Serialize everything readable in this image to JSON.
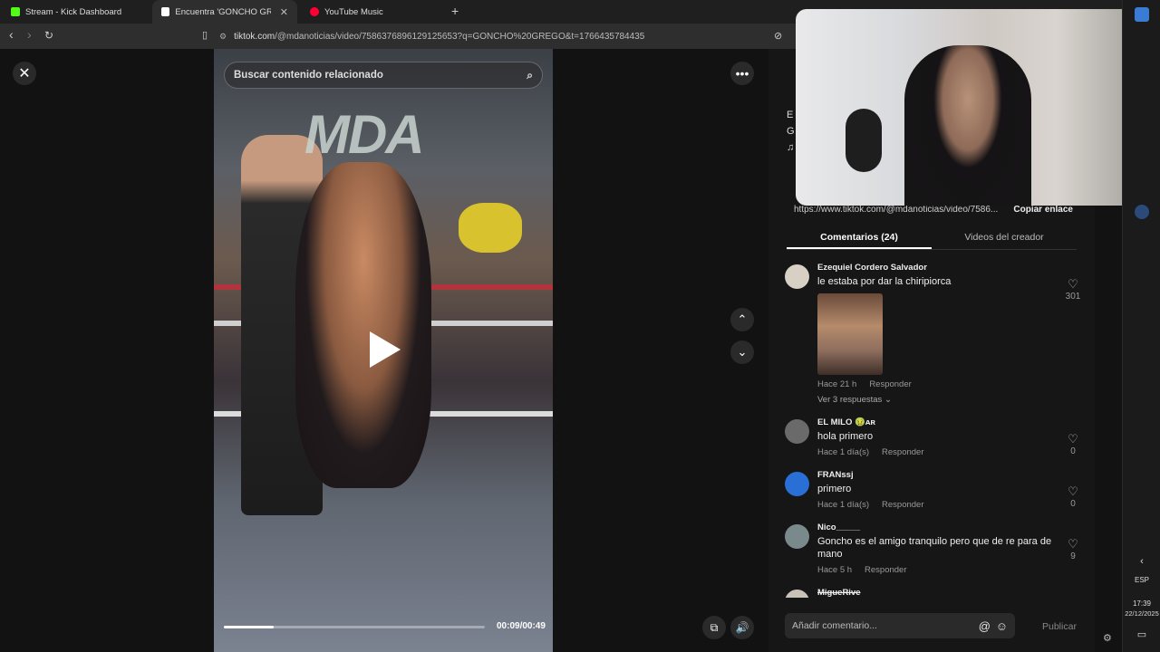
{
  "browser": {
    "tabs": [
      {
        "label": "Stream - Kick Dashboard",
        "favicon_color": "#53fc18"
      },
      {
        "label": "Encuentra 'GONCHO GREGO' en",
        "favicon_color": "#ffffff"
      },
      {
        "label": "YouTube Music",
        "favicon_color": "#ff0033"
      }
    ],
    "url_site": "tiktok.com",
    "url_path": "/@mdanoticias/video/7586376896129125653?q=GONCHO%20GREGO&t=1766435784435"
  },
  "video": {
    "search_placeholder": "Buscar contenido relacionado",
    "overlay_logo": "MDA",
    "time": "00:09/00:49",
    "progress": 0.19
  },
  "panel": {
    "author_snippet_1": "E",
    "author_snippet_2": "G",
    "author_snippet_3": "♫",
    "share_link": "https://www.tiktok.com/@mdanoticias/video/7586...",
    "copy_link_label": "Copiar enlace",
    "tab_comments": "Comentarios (24)",
    "tab_creator": "Videos del creador",
    "comment_placeholder": "Añadir comentario...",
    "publish_label": "Publicar",
    "comments": [
      {
        "user": "Ezequiel Cordero Salvador",
        "text": "le estaba por dar la chiripiorca",
        "time": "Hace 21 h",
        "reply": "Responder",
        "likes": "301",
        "replies": "Ver 3 respuestas",
        "avatar_color": "#d8d0c4"
      },
      {
        "user": "EL MILO 🤢ᴀʀ",
        "text": "hola primero",
        "time": "Hace 1 día(s)",
        "reply": "Responder",
        "likes": "0",
        "avatar_color": "#6a6a6a"
      },
      {
        "user": "FRANssj",
        "text": "primero",
        "time": "Hace 1 día(s)",
        "reply": "Responder",
        "likes": "0",
        "avatar_color": "#2a6fd6"
      },
      {
        "user": "Nico_____",
        "text": "Goncho es el amigo tranquilo pero que de re para de mano",
        "time": "Hace 5 h",
        "reply": "Responder",
        "likes": "9",
        "avatar_color": "#7a8a8c"
      },
      {
        "user": "MigueRive",
        "text": "",
        "time": "",
        "reply": "",
        "likes": "",
        "avatar_color": "#c9c2b8"
      }
    ]
  },
  "taskbar": {
    "lang": "ESP",
    "time": "17:39",
    "date": "22/12/2025"
  }
}
